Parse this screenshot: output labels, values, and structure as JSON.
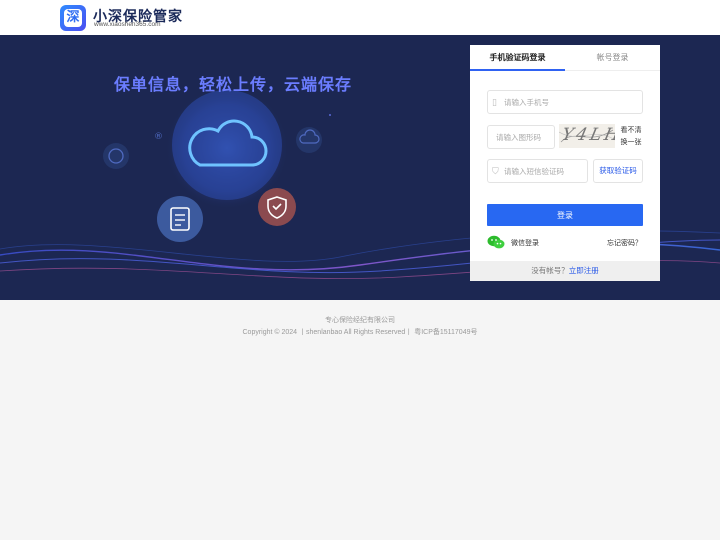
{
  "header": {
    "logo_glyph": "深",
    "brand_name": "小深保险管家",
    "brand_url": "www.xiaoshen365.com"
  },
  "banner": {
    "slogan": "保单信息，轻松上传，云端保存",
    "background_color": "#1c2752",
    "accent_color": "#6b7dff"
  },
  "login": {
    "tabs": [
      {
        "label": "手机验证码登录",
        "active": true
      },
      {
        "label": "帐号登录",
        "active": false
      }
    ],
    "phone_placeholder": "请输入手机号",
    "captcha_placeholder": "请输入图形码",
    "captcha_image_text": "Y4LH",
    "refresh_line1": "看不清",
    "refresh_line2": "换一张",
    "sms_placeholder": "请输入短信验证码",
    "sms_button": "获取验证码",
    "login_button": "登录",
    "wechat_label": "微信登录",
    "forgot_link": "忘记密码？",
    "register_prompt": "没有帐号？",
    "register_link": "立即注册",
    "primary_color": "#2868f2"
  },
  "footer": {
    "company": "专心保险经纪有限公司",
    "copyright": "Copyright © 2024 丨shenlanbao All Rights Reserved丨 粤ICP备15117049号"
  },
  "icons": [
    "phone-icon",
    "shield-icon",
    "wechat-icon",
    "cloud-icon",
    "document-icon",
    "shield-badge-icon",
    "chat-icon",
    "upload-icon"
  ]
}
